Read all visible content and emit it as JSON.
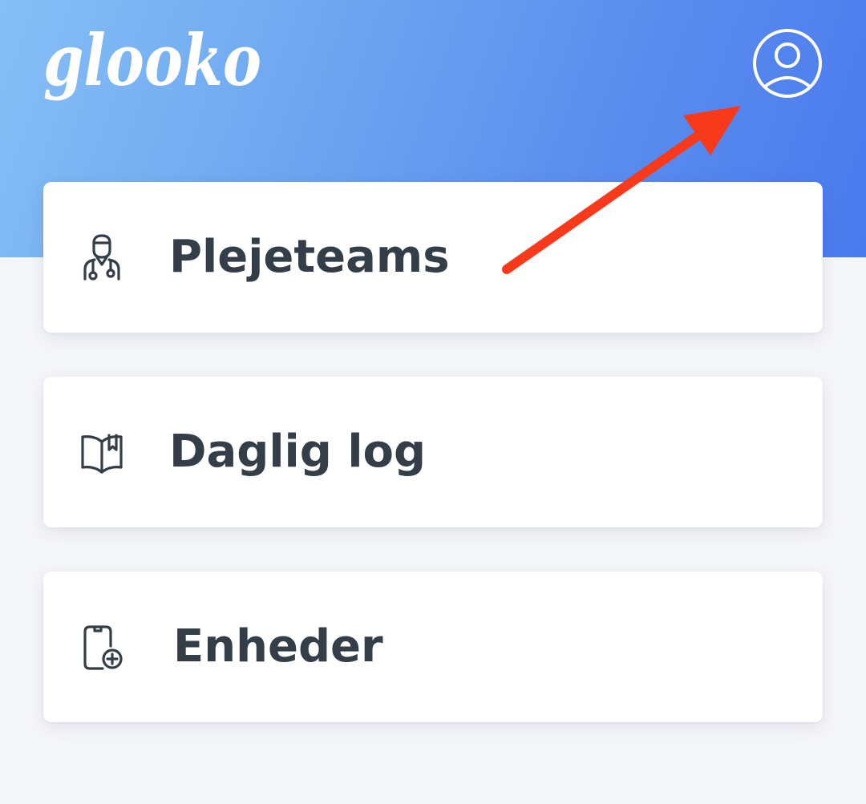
{
  "header": {
    "logo_text": "glooko",
    "profile_icon": "user-circle-icon",
    "background_colors": [
      "#86bff6",
      "#4a7aee"
    ]
  },
  "menu": {
    "items": [
      {
        "label": "Plejeteams",
        "icon": "care-team-icon"
      },
      {
        "label": "Daglig log",
        "icon": "open-book-icon"
      },
      {
        "label": "Enheder",
        "icon": "device-add-icon"
      }
    ]
  },
  "annotation": {
    "icon": "red-arrow-icon",
    "color": "#f73a1c"
  },
  "colors": {
    "text": "#333e48",
    "page_background": "#f5f6fa",
    "card_background": "#ffffff"
  }
}
